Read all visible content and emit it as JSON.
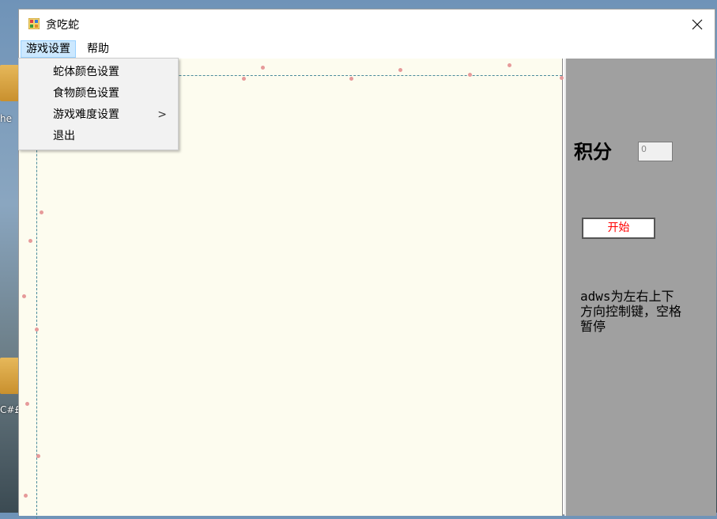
{
  "window": {
    "title": "贪吃蛇"
  },
  "menubar": {
    "items": [
      {
        "label": "游戏设置"
      },
      {
        "label": "帮助"
      }
    ]
  },
  "dropdown": {
    "items": [
      {
        "label": "蛇体颜色设置"
      },
      {
        "label": "食物颜色设置"
      },
      {
        "label": "游戏难度设置",
        "has_submenu": true
      },
      {
        "label": "退出"
      }
    ],
    "submenu_glyph": ">"
  },
  "side_panel": {
    "score_label": "积分",
    "score_value": "0",
    "start_button": "开始",
    "hint": "adws为左右上下方向控制键，空格暂停"
  },
  "desktop": {
    "labels": [
      "he",
      "C#£"
    ]
  },
  "colors": {
    "game_background": "#fdfcef",
    "panel_background": "#a0a0a0",
    "start_text": "#ff0000",
    "menu_highlight": "#cce8ff"
  }
}
